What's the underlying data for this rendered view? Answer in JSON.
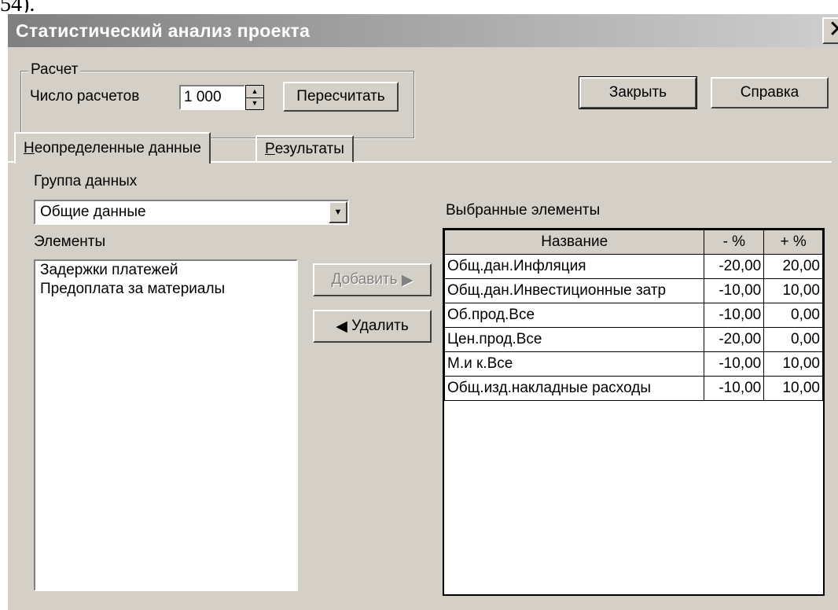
{
  "doc_fragment": "54).",
  "window": {
    "title": "Статистический анализ проекта",
    "close_glyph": "✕"
  },
  "calc_group": {
    "label": "Расчет",
    "count_label": "Число расчетов",
    "count_value": "1 000",
    "recalc_button": "Пересчитать"
  },
  "buttons": {
    "close": "Закрыть",
    "help": "Справка",
    "add": "Добавить",
    "add_arrow": "▶",
    "remove": "Удалить",
    "remove_arrow": "◀"
  },
  "tabs": [
    {
      "first": "Н",
      "rest": "еопределенные данные",
      "active": true
    },
    {
      "first": "Р",
      "rest": "езультаты",
      "active": false
    }
  ],
  "data_group": {
    "label": "Группа данных",
    "selected": "Общие данные"
  },
  "elements": {
    "label": "Элементы",
    "items": [
      "Задержки платежей",
      "Предоплата за материалы"
    ]
  },
  "selected": {
    "label": "Выбранные элементы",
    "columns": [
      "Название",
      "- %",
      "+ %"
    ],
    "rows": [
      [
        "Общ.дан.Инфляция",
        "-20,00",
        "20,00"
      ],
      [
        "Общ.дан.Инвестиционные затр",
        "-10,00",
        "10,00"
      ],
      [
        "Об.прод.Все",
        "-10,00",
        "0,00"
      ],
      [
        "Цен.прод.Все",
        "-20,00",
        "0,00"
      ],
      [
        "М.и к.Все",
        "-10,00",
        "10,00"
      ],
      [
        "Общ.изд.накладные расходы",
        "-10,00",
        "10,00"
      ]
    ]
  }
}
